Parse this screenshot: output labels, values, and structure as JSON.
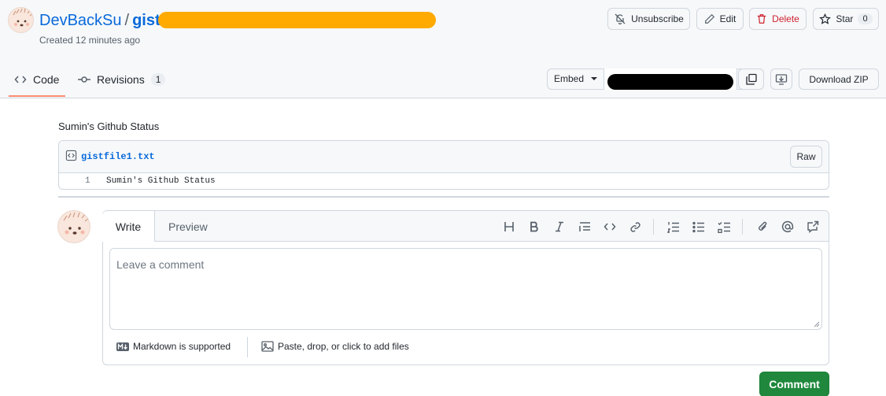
{
  "gist": {
    "owner": "DevBackSu",
    "separator": "/",
    "gist_prefix": "gist:",
    "created": "Created 12 minutes ago"
  },
  "actions": {
    "unsubscribe": "Unsubscribe",
    "edit": "Edit",
    "delete": "Delete",
    "star": "Star",
    "star_count": "0"
  },
  "tabs": {
    "code": "Code",
    "revisions": "Revisions",
    "revisions_count": "1"
  },
  "embed": {
    "label": "Embed",
    "download": "Download ZIP"
  },
  "content": {
    "description": "Sumin's Github Status",
    "file": {
      "name": "gistfile1.txt",
      "raw": "Raw",
      "lines": [
        {
          "num": "1",
          "code": "Sumin's Github Status"
        }
      ]
    }
  },
  "comment": {
    "write_tab": "Write",
    "preview_tab": "Preview",
    "placeholder": "Leave a comment",
    "markdown_note": "Markdown is supported",
    "attach_note": "Paste, drop, or click to add files",
    "submit": "Comment",
    "toolbar": [
      "heading-icon",
      "bold-icon",
      "italic-icon",
      "quote-icon",
      "code-icon",
      "link-icon",
      "ordered-list-icon",
      "unordered-list-icon",
      "task-list-icon",
      "attach-icon",
      "mention-icon",
      "reference-icon"
    ]
  },
  "colors": {
    "link": "#0969da",
    "danger": "#cf222e",
    "primary": "#1f883d",
    "tab_underline": "#fd8c73",
    "redaction_orange": "#ffaa00"
  }
}
